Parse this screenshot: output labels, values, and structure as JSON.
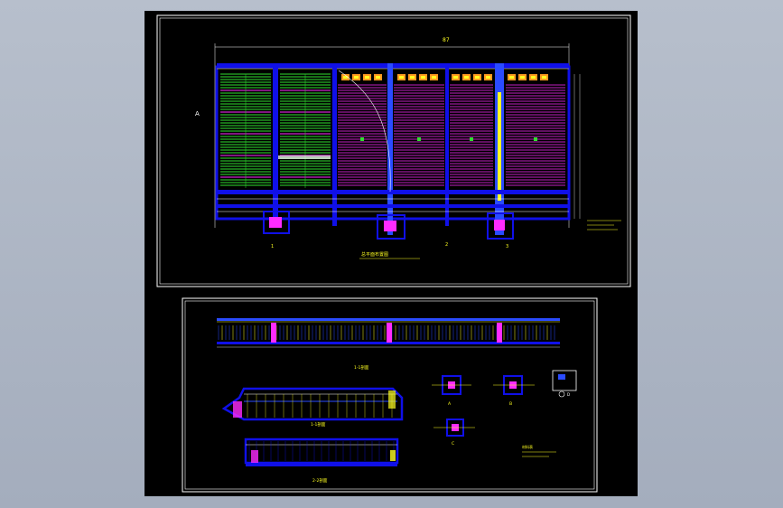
{
  "canvas": {
    "background": "#aab3c2",
    "sheet_background": "#000000"
  },
  "colors": {
    "frame": "#ffffff",
    "blue": "#1010e8",
    "bright_blue": "#2a4bff",
    "green": "#2fe02f",
    "magenta": "#ff2bff",
    "yellow": "#ffff20",
    "cyan": "#20e0e0",
    "orange": "#ff9a20",
    "red": "#ff2020"
  },
  "top_view": {
    "dimension_label": "87",
    "plan_title": "总平面布置图",
    "side_mark": "A",
    "section_marks": [
      "1",
      "2",
      "3"
    ]
  },
  "bottom_view": {
    "section_titles": [
      "1-1剖面",
      "2-2剖面",
      "3-3剖面"
    ],
    "detail_titles": [
      "A",
      "B",
      "C",
      "D"
    ],
    "legend_label": "材料表"
  }
}
